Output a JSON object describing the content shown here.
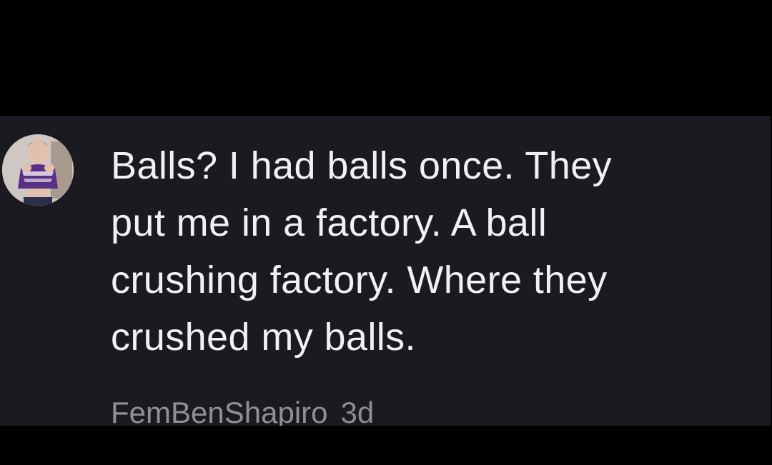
{
  "comment": {
    "text": "Balls? I had balls once. They\nput me in a factory. A ball\ncrushing factory. Where they\ncrushed my balls.",
    "author": {
      "username": "FemBenShapiro",
      "avatar_icon": "profile-photo-avatar"
    },
    "timestamp": "3d"
  },
  "colors": {
    "background": "#000000",
    "card": "#1b1a20",
    "text": "#f1f1f3",
    "meta": "#8c8b91"
  }
}
